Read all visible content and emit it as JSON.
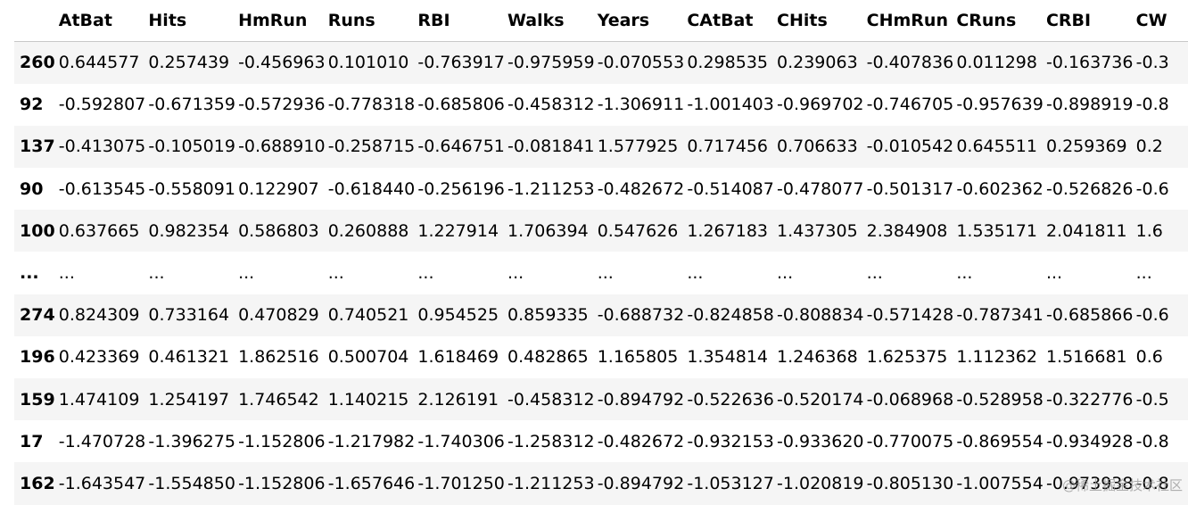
{
  "table": {
    "columns": [
      "AtBat",
      "Hits",
      "HmRun",
      "Runs",
      "RBI",
      "Walks",
      "Years",
      "CAtBat",
      "CHits",
      "CHmRun",
      "CRuns",
      "CRBI",
      "CW"
    ],
    "rows": [
      {
        "index": "260",
        "cells": [
          "0.644577",
          "0.257439",
          "-0.456963",
          "0.101010",
          "-0.763917",
          "-0.975959",
          "-0.070553",
          "0.298535",
          "0.239063",
          "-0.407836",
          "0.011298",
          "-0.163736",
          "-0.3"
        ]
      },
      {
        "index": "92",
        "cells": [
          "-0.592807",
          "-0.671359",
          "-0.572936",
          "-0.778318",
          "-0.685806",
          "-0.458312",
          "-1.306911",
          "-1.001403",
          "-0.969702",
          "-0.746705",
          "-0.957639",
          "-0.898919",
          "-0.8"
        ]
      },
      {
        "index": "137",
        "cells": [
          "-0.413075",
          "-0.105019",
          "-0.688910",
          "-0.258715",
          "-0.646751",
          "-0.081841",
          "1.577925",
          "0.717456",
          "0.706633",
          "-0.010542",
          "0.645511",
          "0.259369",
          "0.2"
        ]
      },
      {
        "index": "90",
        "cells": [
          "-0.613545",
          "-0.558091",
          "0.122907",
          "-0.618440",
          "-0.256196",
          "-1.211253",
          "-0.482672",
          "-0.514087",
          "-0.478077",
          "-0.501317",
          "-0.602362",
          "-0.526826",
          "-0.6"
        ]
      },
      {
        "index": "100",
        "cells": [
          "0.637665",
          "0.982354",
          "0.586803",
          "0.260888",
          "1.227914",
          "1.706394",
          "0.547626",
          "1.267183",
          "1.437305",
          "2.384908",
          "1.535171",
          "2.041811",
          "1.6"
        ]
      },
      {
        "index": "...",
        "cells": [
          "...",
          "...",
          "...",
          "...",
          "...",
          "...",
          "...",
          "...",
          "...",
          "...",
          "...",
          "...",
          "..."
        ]
      },
      {
        "index": "274",
        "cells": [
          "0.824309",
          "0.733164",
          "0.470829",
          "0.740521",
          "0.954525",
          "0.859335",
          "-0.688732",
          "-0.824858",
          "-0.808834",
          "-0.571428",
          "-0.787341",
          "-0.685866",
          "-0.6"
        ]
      },
      {
        "index": "196",
        "cells": [
          "0.423369",
          "0.461321",
          "1.862516",
          "0.500704",
          "1.618469",
          "0.482865",
          "1.165805",
          "1.354814",
          "1.246368",
          "1.625375",
          "1.112362",
          "1.516681",
          "0.6"
        ]
      },
      {
        "index": "159",
        "cells": [
          "1.474109",
          "1.254197",
          "1.746542",
          "1.140215",
          "2.126191",
          "-0.458312",
          "-0.894792",
          "-0.522636",
          "-0.520174",
          "-0.068968",
          "-0.528958",
          "-0.322776",
          "-0.5"
        ]
      },
      {
        "index": "17",
        "cells": [
          "-1.470728",
          "-1.396275",
          "-1.152806",
          "-1.217982",
          "-1.740306",
          "-1.258312",
          "-0.482672",
          "-0.932153",
          "-0.933620",
          "-0.770075",
          "-0.869554",
          "-0.934928",
          "-0.8"
        ]
      },
      {
        "index": "162",
        "cells": [
          "-1.643547",
          "-1.554850",
          "-1.152806",
          "-1.657646",
          "-1.701250",
          "-1.211253",
          "-0.894792",
          "-1.053127",
          "-1.020819",
          "-0.805130",
          "-1.007554",
          "-0.973938",
          "-0.8"
        ]
      }
    ]
  },
  "watermark": "@稀土掘金技术社区"
}
